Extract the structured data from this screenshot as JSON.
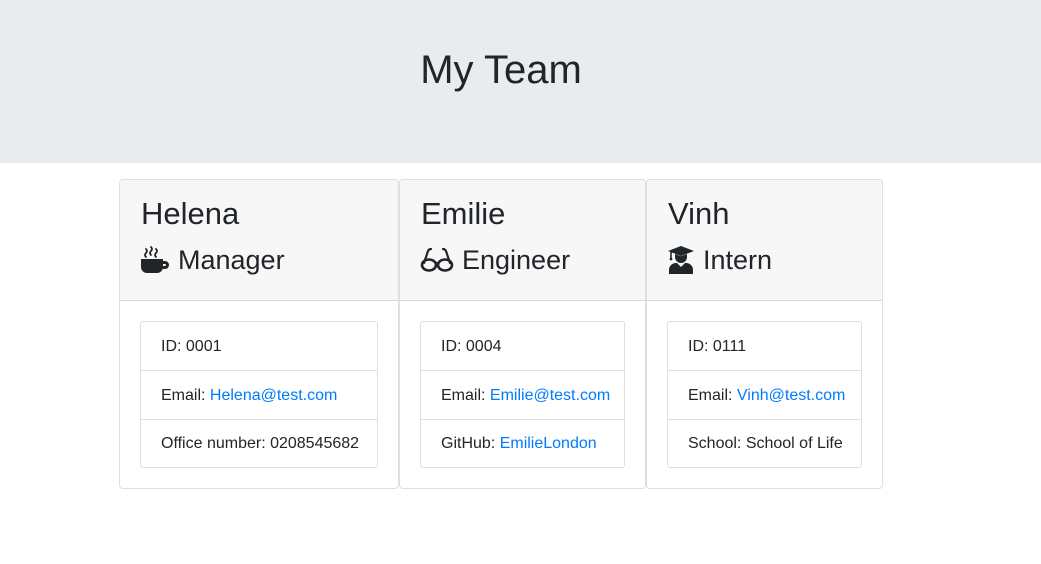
{
  "header": {
    "title": "My Team"
  },
  "team": [
    {
      "name": "Helena",
      "role": "Manager",
      "icon": "coffee-icon",
      "id_label": "ID: 0001",
      "email_label": "Email: ",
      "email": "Helena@test.com",
      "extra_label": "Office number: 0208545682",
      "extra_link": ""
    },
    {
      "name": "Emilie",
      "role": "Engineer",
      "icon": "glasses-icon",
      "id_label": "ID: 0004",
      "email_label": "Email: ",
      "email": "Emilie@test.com",
      "extra_label": "GitHub: ",
      "extra_link": "EmilieLondon"
    },
    {
      "name": "Vinh",
      "role": "Intern",
      "icon": "graduate-icon",
      "id_label": "ID: 0111",
      "email_label": "Email: ",
      "email": "Vinh@test.com",
      "extra_label": "School: School of Life",
      "extra_link": ""
    }
  ],
  "colors": {
    "header_bg": "#e9ecef",
    "card_header_bg": "#f7f7f7",
    "link": "#007bff",
    "text": "#212529"
  }
}
